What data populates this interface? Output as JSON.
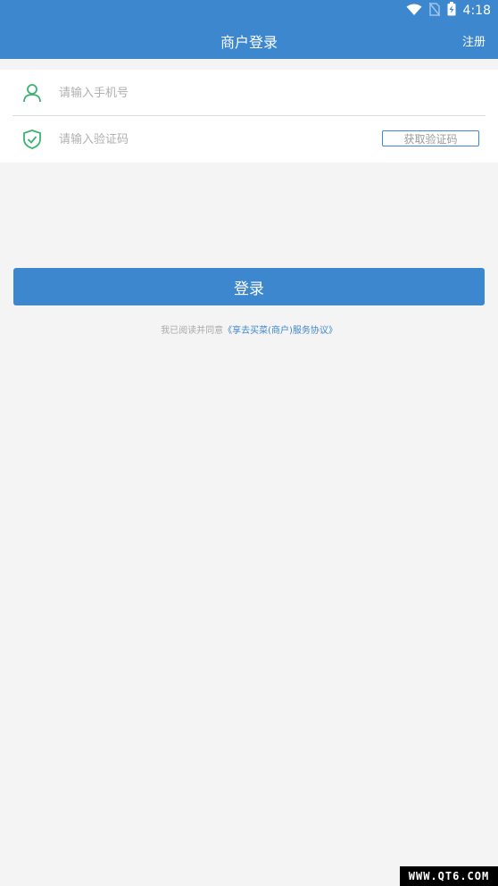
{
  "status_bar": {
    "time": "4:18",
    "icons": [
      "wifi-icon",
      "no-sim-icon",
      "battery-charging-icon"
    ]
  },
  "header": {
    "title": "商户登录",
    "register_label": "注册",
    "background": "#3d87cf"
  },
  "form": {
    "phone": {
      "icon": "user-icon",
      "placeholder": "请输入手机号",
      "value": ""
    },
    "code": {
      "icon": "shield-check-icon",
      "placeholder": "请输入验证码",
      "value": "",
      "get_code_label": "获取验证码"
    }
  },
  "login_button": {
    "label": "登录"
  },
  "agreement": {
    "prefix": "我已阅读并同意",
    "link_text": "《享去买菜(商户)服务协议》"
  },
  "watermark": {
    "text": "WWW.QT6.COM"
  },
  "colors": {
    "primary": "#3d87cf",
    "icon_green": "#3cb371",
    "page_bg": "#f4f4f4"
  }
}
